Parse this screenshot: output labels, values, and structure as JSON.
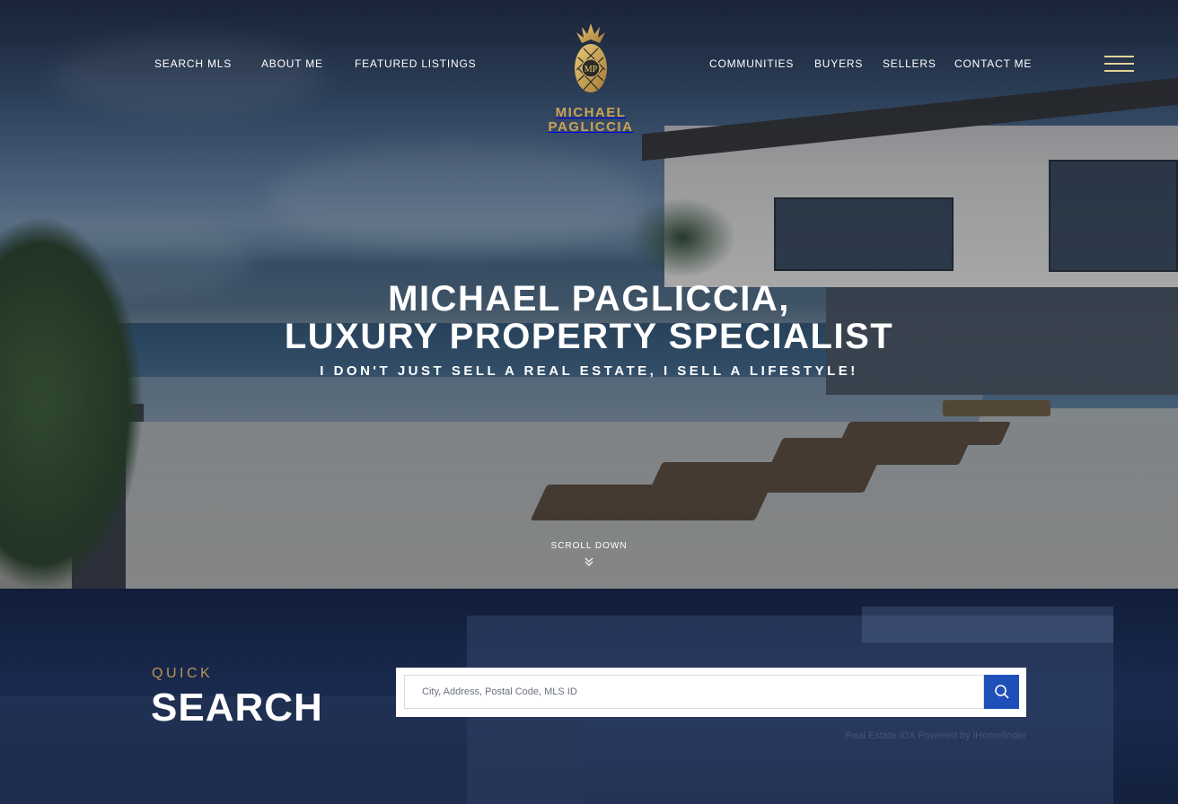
{
  "nav": {
    "left": [
      "SEARCH MLS",
      "ABOUT ME",
      "FEATURED LISTINGS"
    ],
    "right": [
      "COMMUNITIES",
      "BUYERS",
      "SELLERS",
      "CONTACT ME"
    ],
    "menu_icon": "hamburger-icon"
  },
  "logo": {
    "line1": "MICHAEL",
    "line2": "PAGLICCIA",
    "icon": "pineapple-icon",
    "monogram": "MP",
    "color": "#c9a35a"
  },
  "hero": {
    "title_line1": "MICHAEL PAGLICCIA,",
    "title_line2": "LUXURY PROPERTY SPECIALIST",
    "subtitle": "I DON'T JUST SELL A REAL ESTATE, I SELL A LIFESTYLE!",
    "scroll_label": "SCROLL DOWN",
    "scroll_icon": "double-chevron-down-icon"
  },
  "quick_search": {
    "kicker": "QUICK",
    "title": "SEARCH",
    "placeholder": "City, Address, Postal Code, MLS ID",
    "button_icon": "search-icon",
    "credit": "Real Estate IDX Powered by iHomefinder"
  },
  "colors": {
    "gold": "#c9a35a",
    "hamburger": "#e3d39a",
    "accent_blue": "#1f4fb8",
    "navy": "#13203e"
  }
}
